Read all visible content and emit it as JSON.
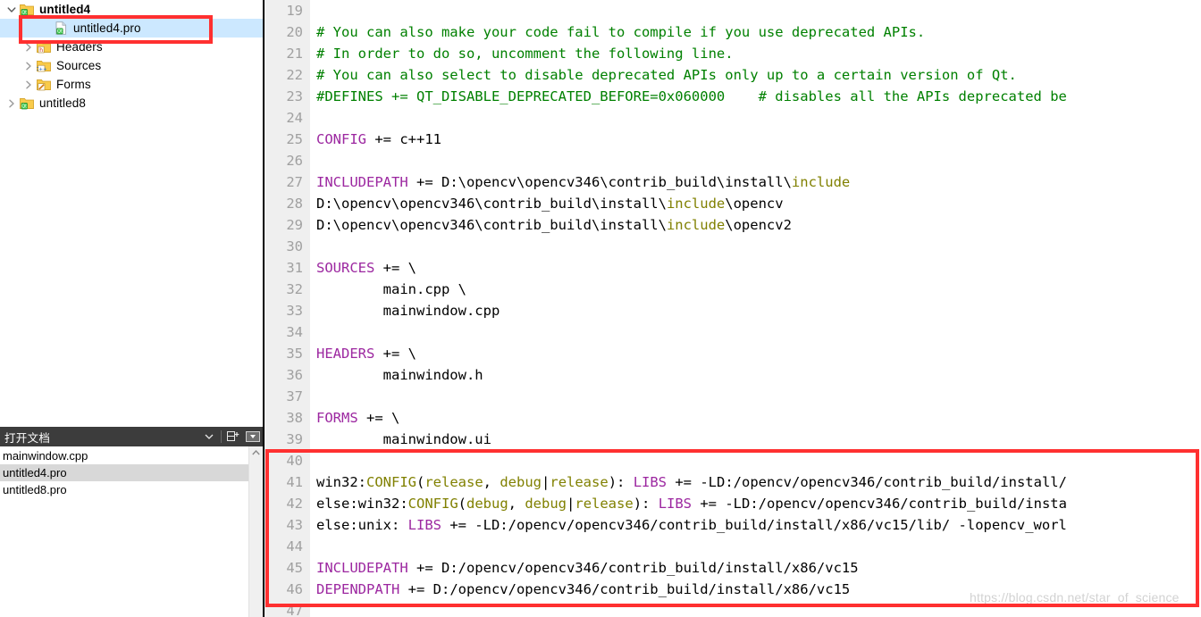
{
  "app": {
    "editor_filename": "untitled4.pro",
    "watermark": "https://blog.csdn.net/star_of_science",
    "accent_highlight": "#cce8ff",
    "annotation_color": "#ff3030",
    "comment_color": "#008000",
    "keyword_color": "#9c27a0",
    "variable_color": "#808000"
  },
  "project_tree": {
    "items": [
      {
        "label": "untitled4",
        "icon": "qt-project-icon",
        "indent": 0,
        "expander": "chevron-down-icon",
        "bold": true,
        "selected": false
      },
      {
        "label": "untitled4.pro",
        "icon": "pro-file-icon",
        "indent": 2,
        "expander": "none",
        "bold": false,
        "selected": true
      },
      {
        "label": "Headers",
        "icon": "headers-folder-icon",
        "indent": 1,
        "expander": "chevron-right-icon",
        "bold": false,
        "selected": false
      },
      {
        "label": "Sources",
        "icon": "sources-folder-icon",
        "indent": 1,
        "expander": "chevron-right-icon",
        "bold": false,
        "selected": false
      },
      {
        "label": "Forms",
        "icon": "forms-folder-icon",
        "indent": 1,
        "expander": "chevron-right-icon",
        "bold": false,
        "selected": false
      },
      {
        "label": "untitled8",
        "icon": "qt-project-icon",
        "indent": 0,
        "expander": "chevron-right-icon",
        "bold": false,
        "selected": false
      }
    ]
  },
  "open_documents": {
    "title": "打开文档",
    "buttons": {
      "filter_label": "▼",
      "split_label": "⊟",
      "close_label": "▭"
    },
    "files": [
      {
        "name": "mainwindow.cpp",
        "active": false
      },
      {
        "name": "untitled4.pro",
        "active": true
      },
      {
        "name": "untitled8.pro",
        "active": false
      }
    ],
    "scroll_up_label": "︿"
  },
  "code": {
    "first_line": 19,
    "lines": [
      {
        "n": 19,
        "tokens": []
      },
      {
        "n": 20,
        "tokens": [
          {
            "t": "comment",
            "s": "# You can also make your code fail to compile if you use deprecated APIs."
          }
        ]
      },
      {
        "n": 21,
        "tokens": [
          {
            "t": "comment",
            "s": "# In order to do so, uncomment the following line."
          }
        ]
      },
      {
        "n": 22,
        "tokens": [
          {
            "t": "comment",
            "s": "# You can also select to disable deprecated APIs only up to a certain version of Qt."
          }
        ]
      },
      {
        "n": 23,
        "tokens": [
          {
            "t": "comment",
            "s": "#DEFINES += QT_DISABLE_DEPRECATED_BEFORE=0x060000"
          },
          {
            "t": "plain",
            "s": "    "
          },
          {
            "t": "comment",
            "s": "# disables all the APIs deprecated be"
          }
        ]
      },
      {
        "n": 24,
        "tokens": []
      },
      {
        "n": 25,
        "tokens": [
          {
            "t": "kw",
            "s": "CONFIG"
          },
          {
            "t": "plain",
            "s": " += c++11"
          }
        ]
      },
      {
        "n": 26,
        "tokens": []
      },
      {
        "n": 27,
        "tokens": [
          {
            "t": "kw",
            "s": "INCLUDEPATH"
          },
          {
            "t": "plain",
            "s": " += D:\\opencv\\opencv346\\contrib_build\\install\\"
          },
          {
            "t": "var",
            "s": "include"
          }
        ]
      },
      {
        "n": 28,
        "tokens": [
          {
            "t": "plain",
            "s": "D:\\opencv\\opencv346\\contrib_build\\install\\"
          },
          {
            "t": "var",
            "s": "include"
          },
          {
            "t": "plain",
            "s": "\\opencv"
          }
        ]
      },
      {
        "n": 29,
        "tokens": [
          {
            "t": "plain",
            "s": "D:\\opencv\\opencv346\\contrib_build\\install\\"
          },
          {
            "t": "var",
            "s": "include"
          },
          {
            "t": "plain",
            "s": "\\opencv2"
          }
        ]
      },
      {
        "n": 30,
        "tokens": []
      },
      {
        "n": 31,
        "tokens": [
          {
            "t": "kw",
            "s": "SOURCES"
          },
          {
            "t": "plain",
            "s": " += \\"
          }
        ]
      },
      {
        "n": 32,
        "tokens": [
          {
            "t": "plain",
            "s": "        main.cpp \\"
          }
        ]
      },
      {
        "n": 33,
        "tokens": [
          {
            "t": "plain",
            "s": "        mainwindow.cpp"
          }
        ]
      },
      {
        "n": 34,
        "tokens": []
      },
      {
        "n": 35,
        "tokens": [
          {
            "t": "kw",
            "s": "HEADERS"
          },
          {
            "t": "plain",
            "s": " += \\"
          }
        ]
      },
      {
        "n": 36,
        "tokens": [
          {
            "t": "plain",
            "s": "        mainwindow.h"
          }
        ]
      },
      {
        "n": 37,
        "tokens": []
      },
      {
        "n": 38,
        "tokens": [
          {
            "t": "kw",
            "s": "FORMS"
          },
          {
            "t": "plain",
            "s": " += \\"
          }
        ]
      },
      {
        "n": 39,
        "tokens": [
          {
            "t": "plain",
            "s": "        mainwindow.ui"
          }
        ]
      },
      {
        "n": 40,
        "tokens": []
      },
      {
        "n": 41,
        "tokens": [
          {
            "t": "plain",
            "s": "win32:"
          },
          {
            "t": "var",
            "s": "CONFIG"
          },
          {
            "t": "plain",
            "s": "("
          },
          {
            "t": "var",
            "s": "release"
          },
          {
            "t": "plain",
            "s": ", "
          },
          {
            "t": "var",
            "s": "debug"
          },
          {
            "t": "plain",
            "s": "|"
          },
          {
            "t": "var",
            "s": "release"
          },
          {
            "t": "plain",
            "s": "): "
          },
          {
            "t": "kw",
            "s": "LIBS"
          },
          {
            "t": "plain",
            "s": " += -LD:/opencv/opencv346/contrib_build/install/"
          }
        ]
      },
      {
        "n": 42,
        "tokens": [
          {
            "t": "plain",
            "s": "else:win32:"
          },
          {
            "t": "var",
            "s": "CONFIG"
          },
          {
            "t": "plain",
            "s": "("
          },
          {
            "t": "var",
            "s": "debug"
          },
          {
            "t": "plain",
            "s": ", "
          },
          {
            "t": "var",
            "s": "debug"
          },
          {
            "t": "plain",
            "s": "|"
          },
          {
            "t": "var",
            "s": "release"
          },
          {
            "t": "plain",
            "s": "): "
          },
          {
            "t": "kw",
            "s": "LIBS"
          },
          {
            "t": "plain",
            "s": " += -LD:/opencv/opencv346/contrib_build/insta"
          }
        ]
      },
      {
        "n": 43,
        "tokens": [
          {
            "t": "plain",
            "s": "else:unix: "
          },
          {
            "t": "kw",
            "s": "LIBS"
          },
          {
            "t": "plain",
            "s": " += -LD:/opencv/opencv346/contrib_build/install/x86/vc15/lib/ -lopencv_worl"
          }
        ]
      },
      {
        "n": 44,
        "tokens": []
      },
      {
        "n": 45,
        "tokens": [
          {
            "t": "kw",
            "s": "INCLUDEPATH"
          },
          {
            "t": "plain",
            "s": " += D:/opencv/opencv346/contrib_build/install/x86/vc15"
          }
        ]
      },
      {
        "n": 46,
        "tokens": [
          {
            "t": "kw",
            "s": "DEPENDPATH"
          },
          {
            "t": "plain",
            "s": " += D:/opencv/opencv346/contrib_build/install/x86/vc15"
          }
        ]
      },
      {
        "n": 47,
        "tokens": []
      }
    ]
  }
}
